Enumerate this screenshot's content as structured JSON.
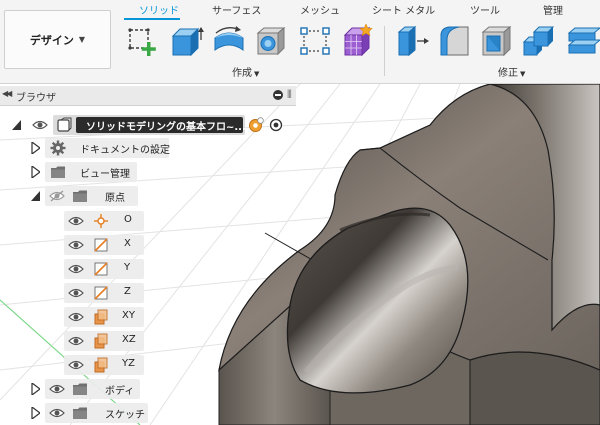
{
  "toolbar": {
    "workspace_button": "デザイン",
    "tabs": [
      "ソリッド",
      "サーフェス",
      "メッシュ",
      "シート メタル",
      "ツール",
      "管理"
    ],
    "active_tab": "ソリッド",
    "groups": {
      "create": "作成",
      "modify": "修正"
    },
    "tools": {
      "create": [
        "create-sketch",
        "extrude",
        "revolve",
        "hole",
        "pattern",
        "form"
      ],
      "modify": [
        "press-pull",
        "fillet",
        "shell",
        "combine",
        "align"
      ]
    },
    "accent_color": "#0696d7"
  },
  "browser": {
    "title": "ブラウザ",
    "root": {
      "label": "ソリッドモデリングの基本フロ~..."
    },
    "items": [
      {
        "label": "ドキュメントの設定",
        "icon": "gear-icon"
      },
      {
        "label": "ビュー管理",
        "icon": "folder-icon"
      },
      {
        "label": "原点",
        "icon": "folder-icon"
      },
      {
        "label": "O",
        "icon": "origin-point-icon"
      },
      {
        "label": "X",
        "icon": "axis-icon"
      },
      {
        "label": "Y",
        "icon": "axis-icon"
      },
      {
        "label": "Z",
        "icon": "axis-icon"
      },
      {
        "label": "XY",
        "icon": "plane-icon"
      },
      {
        "label": "XZ",
        "icon": "plane-icon"
      },
      {
        "label": "YZ",
        "icon": "plane-icon"
      },
      {
        "label": "ボディ",
        "icon": "folder-icon"
      },
      {
        "label": "スケッチ",
        "icon": "folder-icon"
      }
    ]
  }
}
